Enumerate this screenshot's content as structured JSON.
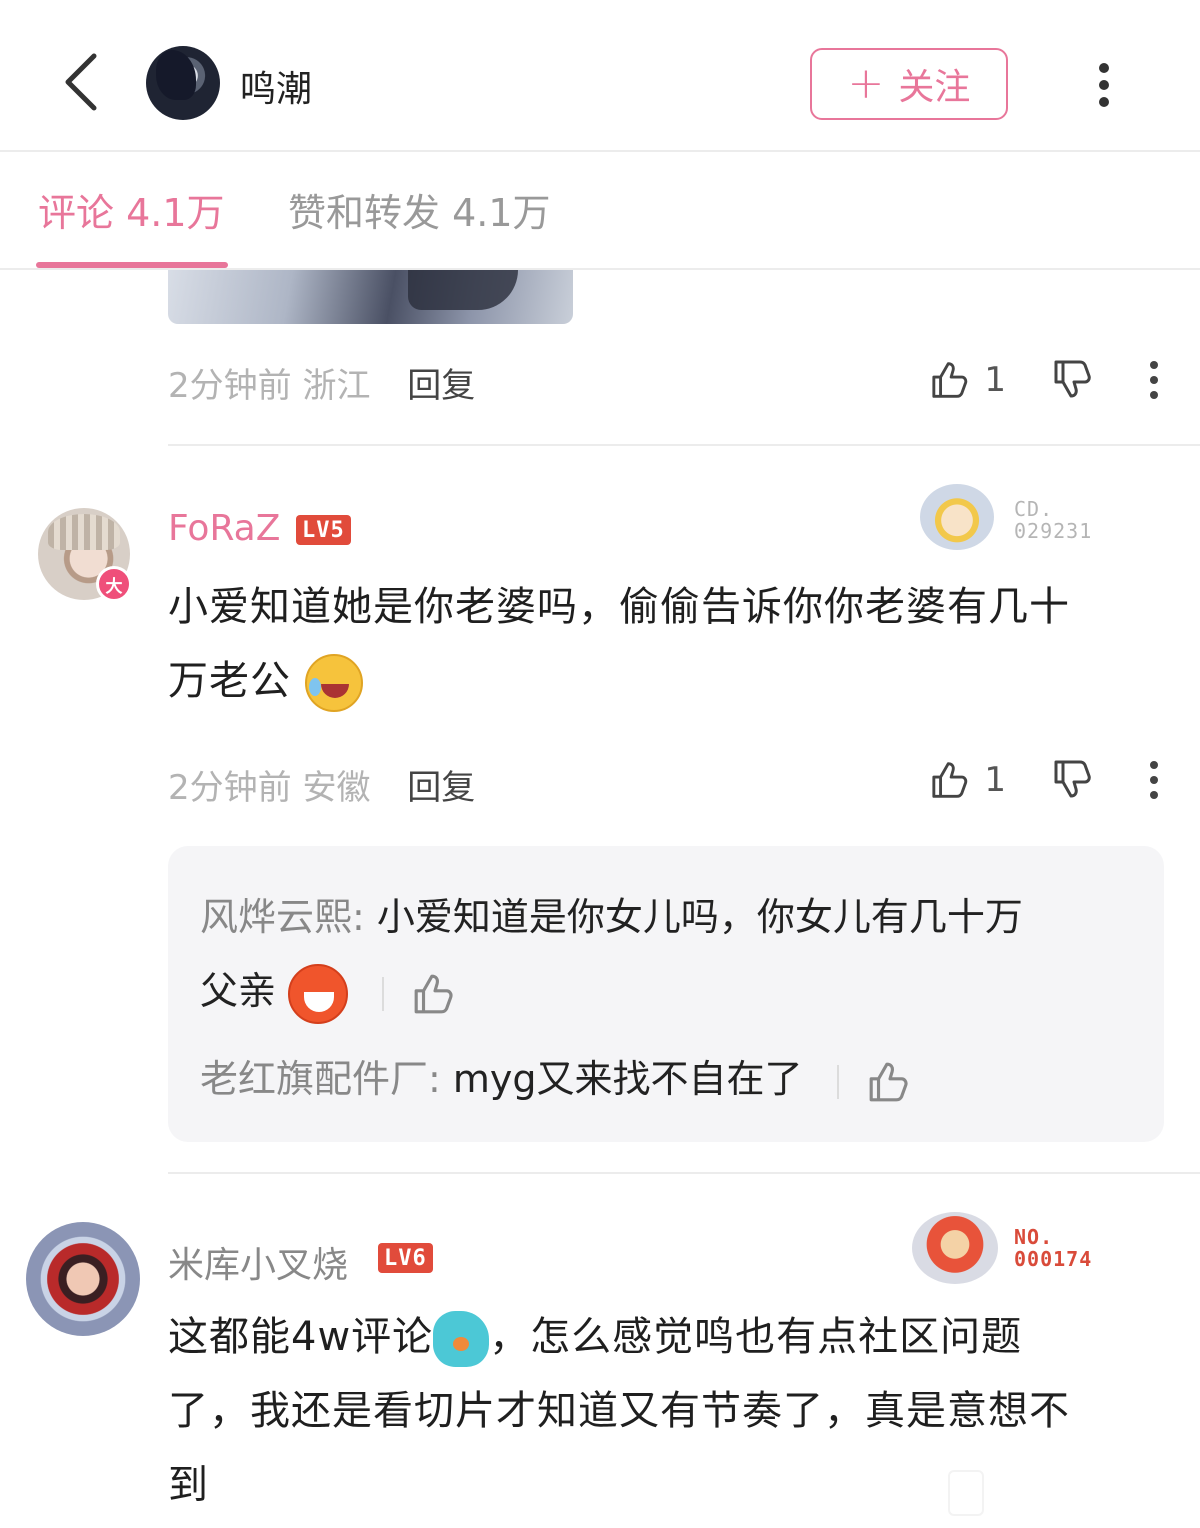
{
  "header": {
    "back_icon": "chevron-left-icon",
    "title": "鸣潮",
    "follow_label": "关注",
    "follow_icon": "plus-icon",
    "more_icon": "more-vertical-icon"
  },
  "tabs": [
    {
      "label": "评论 4.1万",
      "active": true
    },
    {
      "label": "赞和转发 4.1万",
      "active": false
    }
  ],
  "previous_comment": {
    "time": "2分钟前",
    "location": "浙江",
    "reply_label": "回复",
    "likes": "1"
  },
  "comments": [
    {
      "username": "FoRaZ",
      "level": "LV5",
      "badge": "大",
      "card_no": [
        "CD.",
        "029231"
      ],
      "text_1": "小爱知道她是你老婆吗，偷偷告诉你你老婆有几十",
      "text_2": "万老公",
      "emoji": "laughing-crying-emoji",
      "time": "2分钟前",
      "location": "安徽",
      "reply_label": "回复",
      "likes": "1",
      "replies": [
        {
          "name": "风烨云熙:",
          "text_1": "小爱知道是你女儿吗，你女儿有几十万",
          "text_2": "父亲",
          "emoji": "yelling-laugh-emoji"
        },
        {
          "name": "老红旗配件厂:",
          "text_1": "myg又来找不自在了"
        }
      ]
    },
    {
      "username": "米库小叉烧",
      "level": "LV6",
      "card_no": [
        "NO.",
        "000174"
      ],
      "text_1a": "这都能4w评论",
      "text_1b": "，怎么感觉鸣也有点社区问题",
      "text_2": "了，我还是看切片才知道又有节奏了，真是意想不",
      "text_3": "到",
      "emoji": "confused-bird-emoji"
    }
  ],
  "colors": {
    "accent": "#e8769a",
    "level": "#e14b3b",
    "badge": "#ef4f7a",
    "muted": "#b3b3b3"
  }
}
